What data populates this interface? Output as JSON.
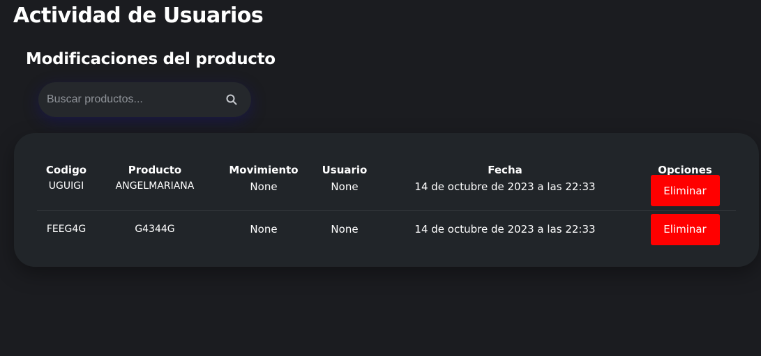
{
  "header": {
    "title": "Actividad de Usuarios",
    "section_title": "Modificaciones del producto"
  },
  "search": {
    "placeholder": "Buscar productos...",
    "value": "",
    "icon": "search-icon"
  },
  "table": {
    "columns": [
      "Codigo",
      "Producto",
      "Movimiento",
      "Usuario",
      "Fecha",
      "Opciones"
    ],
    "rows": [
      {
        "codigo": "UGUIGI",
        "producto": "ANGELMARIANA",
        "movimiento": "None",
        "usuario": "None",
        "fecha": "14 de octubre de 2023 a las 22:33",
        "accion": "Eliminar"
      },
      {
        "codigo": "FEEG4G",
        "producto": "G4344G",
        "movimiento": "None",
        "usuario": "None",
        "fecha": "14 de octubre de 2023 a las 22:33",
        "accion": "Eliminar"
      }
    ]
  },
  "colors": {
    "background": "#1b1c20",
    "card": "#212529",
    "search_box": "#25282c",
    "delete_button": "#ff0000",
    "text": "#ffffff"
  }
}
